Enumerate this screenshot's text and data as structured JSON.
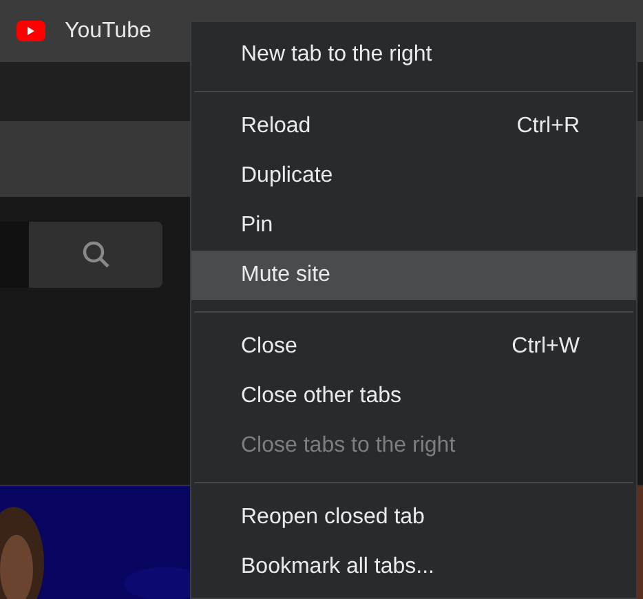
{
  "tab": {
    "title": "YouTube"
  },
  "menu": {
    "sections": [
      [
        {
          "label": "New tab to the right",
          "disabled": false,
          "selected": false
        }
      ],
      [
        {
          "label": "Reload",
          "shortcut": "Ctrl+R",
          "disabled": false,
          "selected": false
        },
        {
          "label": "Duplicate",
          "disabled": false,
          "selected": false
        },
        {
          "label": "Pin",
          "disabled": false,
          "selected": false
        },
        {
          "label": "Mute site",
          "disabled": false,
          "selected": true
        }
      ],
      [
        {
          "label": "Close",
          "shortcut": "Ctrl+W",
          "disabled": false,
          "selected": false
        },
        {
          "label": "Close other tabs",
          "disabled": false,
          "selected": false
        },
        {
          "label": "Close tabs to the right",
          "disabled": true,
          "selected": false
        }
      ],
      [
        {
          "label": "Reopen closed tab",
          "disabled": false,
          "selected": false
        },
        {
          "label": "Bookmark all tabs...",
          "disabled": false,
          "selected": false
        }
      ]
    ]
  }
}
